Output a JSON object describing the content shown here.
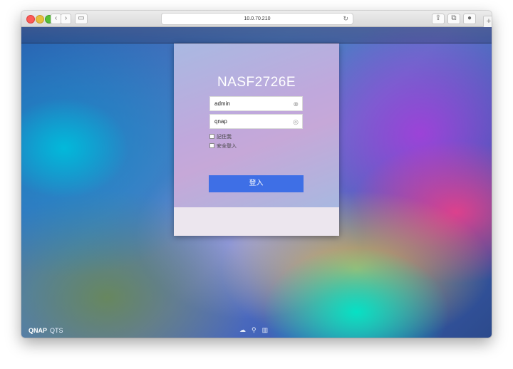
{
  "browser": {
    "url": "10.0.70.210",
    "back_icon": "chevron-left-icon",
    "forward_icon": "chevron-right-icon",
    "sidebar_icon": "sidebar-icon",
    "reload_icon": "reload-icon",
    "share_icon": "share-icon",
    "tabs_icon": "tabs-icon",
    "download_icon": "download-icon",
    "new_tab_icon": "plus-icon"
  },
  "login": {
    "device_name": "NASF2726E",
    "username": "admin",
    "password": "qnap",
    "remember_label": "記住我",
    "secure_label": "安全登入",
    "submit_label": "登入"
  },
  "footer": {
    "brand": "QNAP",
    "os": "QTS",
    "icons": [
      "cloud-icon",
      "tools-icon",
      "book-icon"
    ]
  },
  "colors": {
    "accent": "#3e6fe6",
    "card_bottom": "#ece6ee"
  }
}
